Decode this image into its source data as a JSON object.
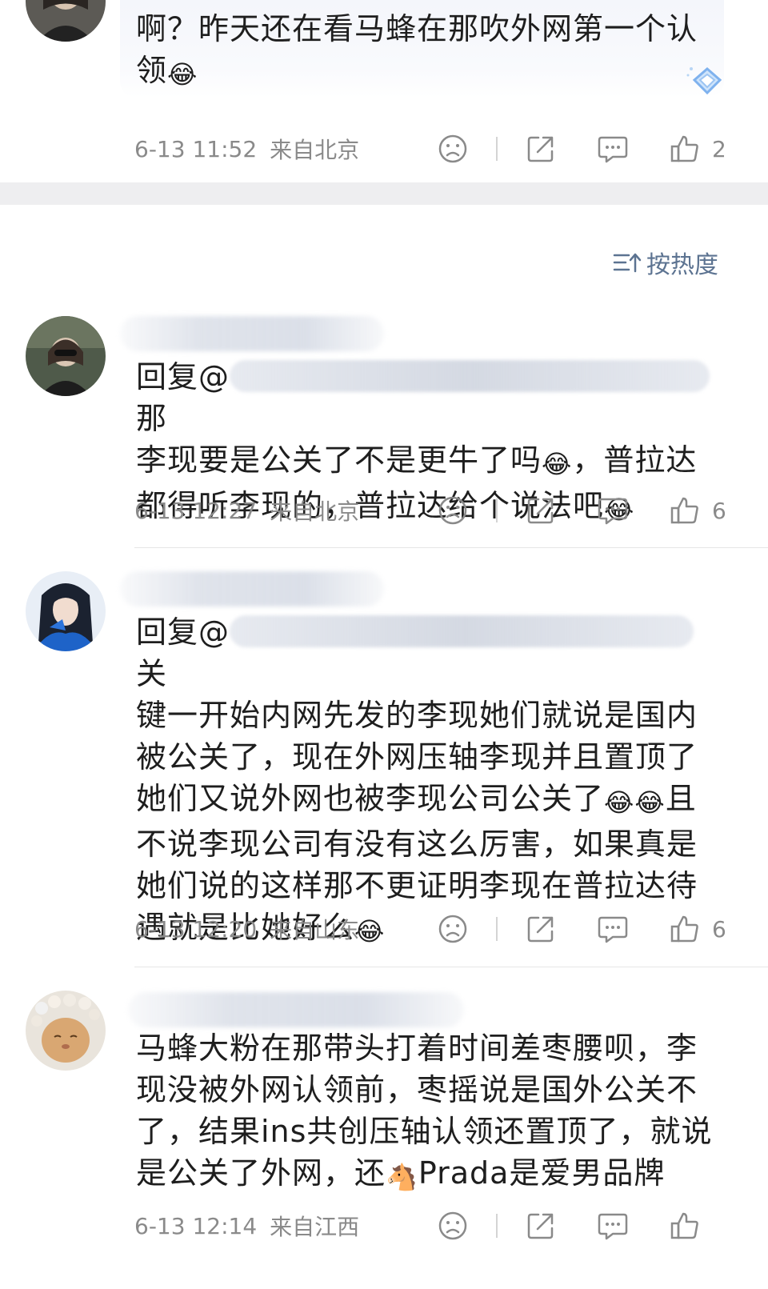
{
  "sort": {
    "label": "按热度"
  },
  "comments": [
    {
      "text_line1": "啊？昨天还在看马蜂在那吹外网第一个认",
      "text_line2": "领",
      "emoji": "😂",
      "time": "6-13 11:52",
      "location": "来自北京",
      "likes": "2"
    },
    {
      "reply_prefix": "回复@",
      "reply_tail": "那",
      "text_line2": "李现要是公关了不是更牛了吗",
      "text_line2b": "，普拉达",
      "text_line3": "都得听李现的，普拉达给个说法吧",
      "emoji": "😂",
      "time": "6-13 12:27",
      "location": "来自北京",
      "likes": "6"
    },
    {
      "reply_prefix": "回复@",
      "reply_tail": "关",
      "text_line2": "键一开始内网先发的李现她们就说是国内",
      "text_line3": "被公关了，现在外网压轴李现并且置顶了",
      "text_line4": "她们又说外网也被李现公司公关了",
      "text_line4b": "且",
      "text_line5": "不说李现公司有没有这么厉害，如果真是",
      "text_line6": "她们说的这样那不更证明李现在普拉达待",
      "text_line7": "遇就是比她好么",
      "emoji": "😂",
      "time": "6-13 12:20",
      "location": "来自山东",
      "likes": "6"
    },
    {
      "text_line1": "马蜂大粉在那带头打着时间差枣腰呗，李",
      "text_line2": "现没被外网认领前，枣摇说是国外公关不",
      "text_line3": "了，结果ins共创压轴认领还置顶了，就说",
      "text_line4": "是公关了外网，还",
      "text_line4b": "Prada是爱男品牌",
      "emoji_horse": "🐴",
      "time": "6-13 12:14",
      "location": "来自江西"
    }
  ],
  "colors": {
    "meta": "#8a8a8a",
    "sort": "#5c7391",
    "band": "#eeeef0"
  }
}
